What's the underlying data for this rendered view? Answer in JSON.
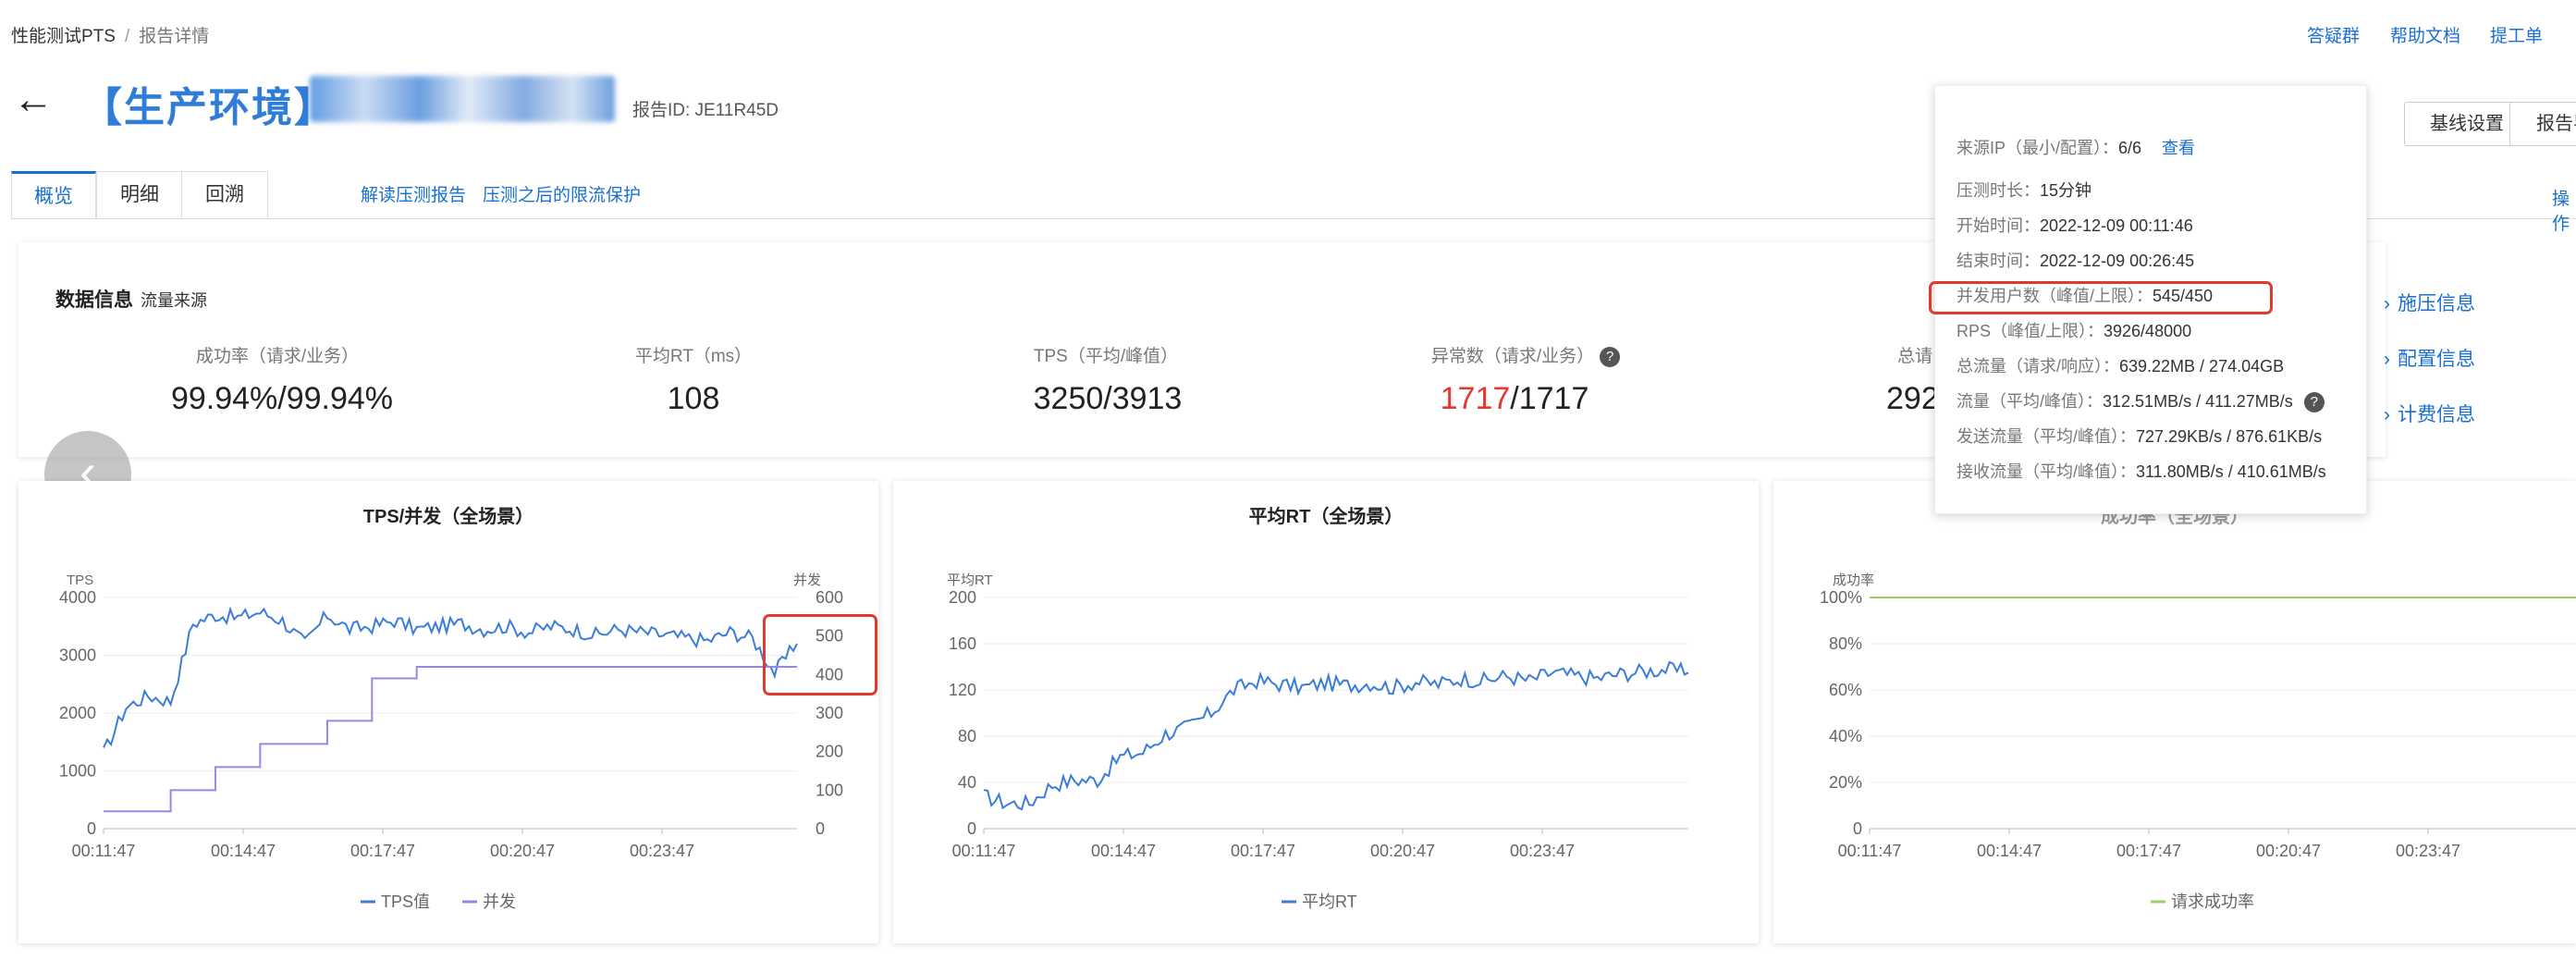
{
  "breadcrumb": {
    "root": "性能测试PTS",
    "separator": "/",
    "current": "报告详情"
  },
  "top_links": [
    "答疑群",
    "帮助文档",
    "提工单"
  ],
  "title": {
    "back_icon": "arrow-left-icon",
    "env": "【生产环境】",
    "name_visible": "Y",
    "report_id": "报告ID:  JE11R45D"
  },
  "header_buttons": [
    "基线设置",
    "报告导"
  ],
  "tabs": [
    "概览",
    "明细",
    "回溯"
  ],
  "tab_links": [
    "解读压测报告",
    "压测之后的限流保护"
  ],
  "op_link": "操作",
  "info": {
    "title": "数据信息",
    "subtitle": "流量来源",
    "metrics": [
      {
        "label": "成功率（请求/业务）",
        "value": "99.94%/99.94%"
      },
      {
        "label": "平均RT（ms）",
        "value": "108"
      },
      {
        "label": "TPS（平均/峰值）",
        "value": "3250/3913"
      },
      {
        "label": "异常数（请求/业务）",
        "value_red": "1717",
        "value_rest": "/1717",
        "help_icon": "question-circle-icon"
      },
      {
        "label": "总请",
        "value": "292"
      }
    ],
    "side_links": [
      "施压信息",
      "配置信息",
      "计费信息"
    ]
  },
  "tooltip": {
    "rows": [
      {
        "key": "来源IP（最小/配置）：",
        "value": "6/6",
        "link": "查看"
      },
      {
        "key": "压测时长：",
        "value": "15分钟"
      },
      {
        "key": "开始时间：",
        "value": "2022-12-09 00:11:46"
      },
      {
        "key": "结束时间：",
        "value": "2022-12-09 00:26:45"
      },
      {
        "key": "并发用户数（峰值/上限）：",
        "value": "545/450"
      },
      {
        "key": "RPS（峰值/上限）：",
        "value": "3926/48000"
      },
      {
        "key": "总流量（请求/响应）：",
        "value": "639.22MB / 274.04GB"
      },
      {
        "key": "流量（平均/峰值）：",
        "value": "312.51MB/s / 411.27MB/s"
      },
      {
        "key": "发送流量（平均/峰值）：",
        "value": "727.29KB/s / 876.61KB/s"
      },
      {
        "key": "接收流量（平均/峰值）：",
        "value": "311.80MB/s / 410.61MB/s"
      }
    ]
  },
  "colors": {
    "accent": "#1a6fd3",
    "tps_line": "#3b7dd8",
    "concurrency_line": "#9b86e8",
    "success_line": "#9ccc65",
    "highlight": "#e03a2c"
  },
  "chart_data": [
    {
      "type": "line",
      "title": "TPS/并发（全场景）",
      "ylabel": "TPS",
      "y2label": "并发",
      "x": [
        "00:11:47",
        "00:14:47",
        "00:17:47",
        "00:20:47",
        "00:23:47"
      ],
      "ylim": [
        0,
        4000
      ],
      "y2lim": [
        0,
        600
      ],
      "yticks": [
        0,
        1000,
        2000,
        3000,
        4000
      ],
      "y2ticks": [
        0,
        100,
        200,
        300,
        400,
        500,
        600
      ],
      "series": [
        {
          "name": "TPS值",
          "axis": "left",
          "values": [
            1300,
            2100,
            2300,
            2200,
            3550,
            3700,
            3650,
            3750,
            3600,
            3200,
            3700,
            3450,
            3500,
            3600,
            3450,
            3500,
            3550,
            3450,
            3500,
            3400,
            3500,
            3450,
            3350,
            3450,
            3400,
            3350,
            3300,
            3250,
            3400,
            3300,
            2700,
            3200
          ]
        },
        {
          "name": "并发",
          "axis": "right",
          "values": [
            45,
            45,
            45,
            100,
            100,
            160,
            160,
            220,
            220,
            220,
            280,
            280,
            390,
            390,
            420,
            420,
            420,
            420,
            420,
            420,
            420,
            420,
            420,
            420,
            420,
            420,
            420,
            420,
            420,
            420,
            420,
            420
          ]
        }
      ],
      "legend": "bottom"
    },
    {
      "type": "line",
      "title": "平均RT（全场景）",
      "ylabel": "平均RT",
      "x": [
        "00:11:47",
        "00:14:47",
        "00:17:47",
        "00:20:47",
        "00:23:47"
      ],
      "ylim": [
        0,
        200
      ],
      "yticks": [
        0,
        40,
        80,
        120,
        160,
        200
      ],
      "series": [
        {
          "name": "平均RT",
          "values": [
            28,
            22,
            22,
            38,
            42,
            42,
            62,
            66,
            82,
            88,
            100,
            120,
            128,
            125,
            122,
            126,
            124,
            126,
            122,
            127,
            125,
            130,
            128,
            132,
            128,
            135,
            132,
            130,
            134,
            136,
            138,
            135
          ]
        }
      ],
      "legend": "bottom"
    },
    {
      "type": "line",
      "title": "成功率（全场景）",
      "ylabel": "成功率",
      "x": [
        "00:11:47",
        "00:14:47",
        "00:17:47",
        "00:20:47",
        "00:23:47"
      ],
      "ylim": [
        0,
        100
      ],
      "yticks": [
        "0",
        "20%",
        "40%",
        "60%",
        "80%",
        "100%"
      ],
      "series": [
        {
          "name": "请求成功率",
          "values": [
            100,
            100,
            100,
            100,
            100,
            100,
            100,
            100,
            100,
            100
          ]
        }
      ],
      "legend": "bottom"
    }
  ]
}
